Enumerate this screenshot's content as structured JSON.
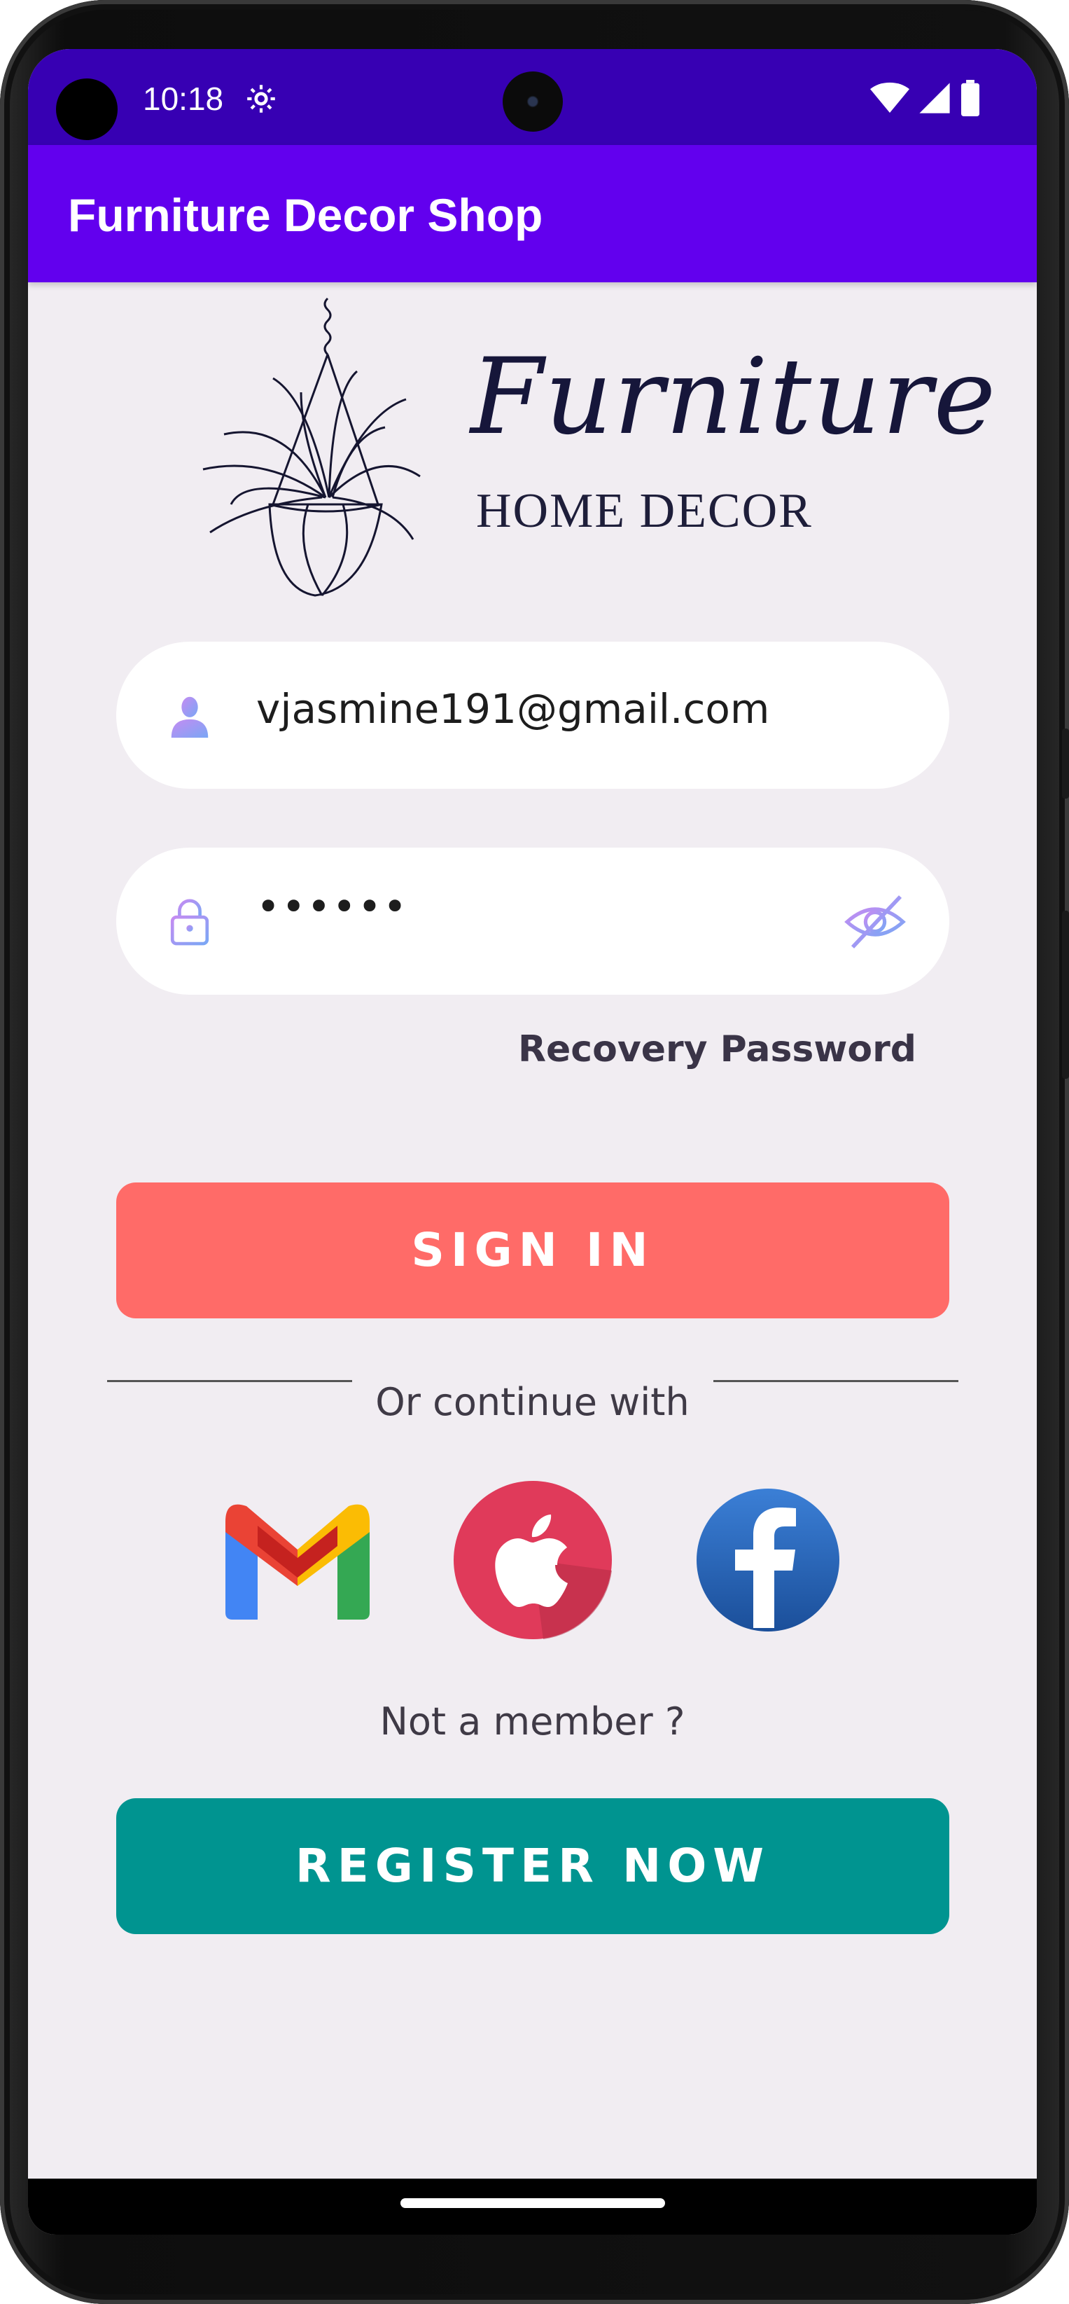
{
  "status_bar": {
    "time": "10:18",
    "icons": [
      "gear-icon",
      "wifi-icon",
      "signal-icon",
      "battery-icon"
    ]
  },
  "app_bar": {
    "title": "Furniture Decor Shop"
  },
  "logo": {
    "script_text": "Furniture",
    "sub_text": "HOME DECOR"
  },
  "email_field": {
    "value": "vjasmine191@gmail.com",
    "icon": "user-icon"
  },
  "password_field": {
    "value": "••••••",
    "icon": "lock-icon",
    "toggle_icon": "eye-off-icon"
  },
  "recovery_link": "Recovery Password",
  "sign_in_button": "SIGN IN",
  "divider_text": "Or continue with",
  "social_logins": [
    "gmail-icon",
    "apple-icon",
    "facebook-icon"
  ],
  "not_member_text": "Not a member ?",
  "register_button": "REGISTER NOW",
  "colors": {
    "status_bar": "#3700b3",
    "app_bar": "#6200ee",
    "background": "#f1edf2",
    "sign_in": "#ff6b68",
    "register": "#009490"
  }
}
